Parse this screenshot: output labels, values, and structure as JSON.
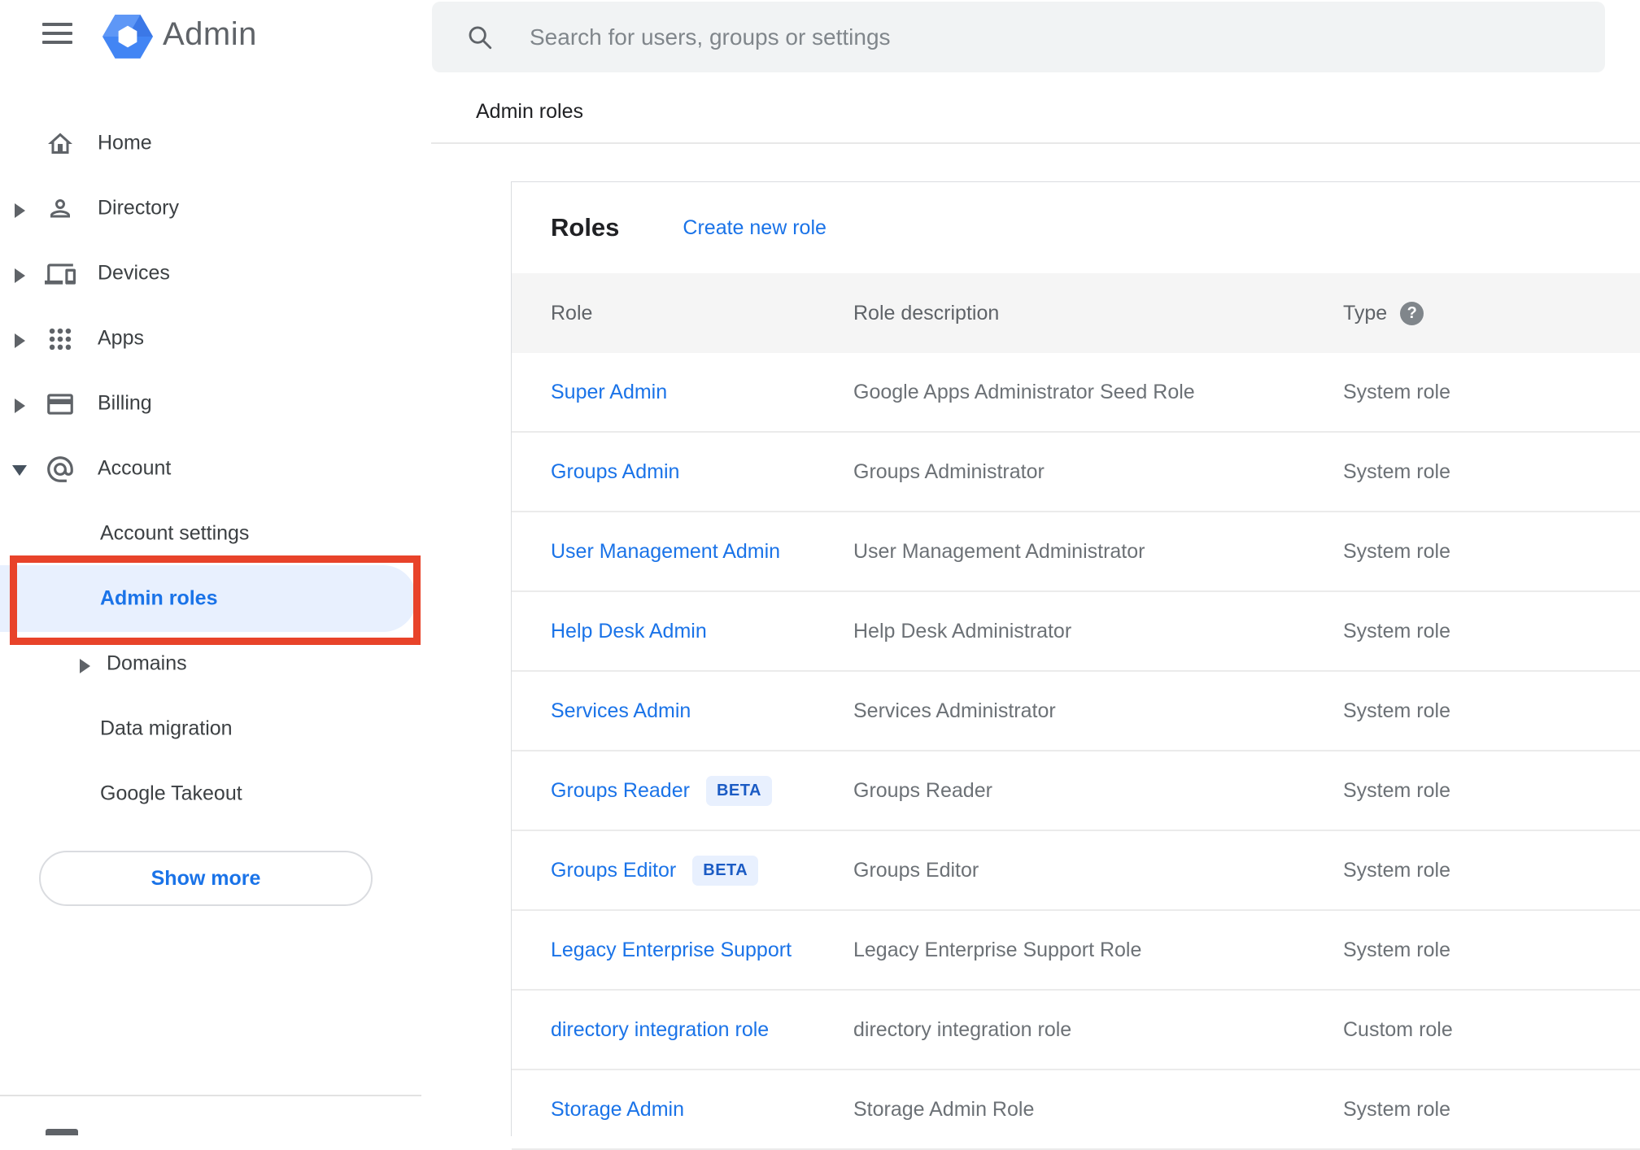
{
  "header": {
    "app_title": "Admin",
    "search_placeholder": "Search for users, groups or settings",
    "breadcrumb": "Admin roles"
  },
  "sidebar": {
    "items": [
      {
        "label": "Home",
        "icon": "home-icon",
        "triangle": "none",
        "level": 0
      },
      {
        "label": "Directory",
        "icon": "person-icon",
        "triangle": "right",
        "level": 0
      },
      {
        "label": "Devices",
        "icon": "devices-icon",
        "triangle": "right",
        "level": 0
      },
      {
        "label": "Apps",
        "icon": "apps-grid-icon",
        "triangle": "right",
        "level": 0
      },
      {
        "label": "Billing",
        "icon": "credit-card-icon",
        "triangle": "right",
        "level": 0
      },
      {
        "label": "Account",
        "icon": "at-sign-icon",
        "triangle": "down",
        "level": 0
      },
      {
        "label": "Account settings",
        "icon": "",
        "triangle": "none",
        "level": 1
      },
      {
        "label": "Admin roles",
        "icon": "",
        "triangle": "none",
        "level": 1,
        "selected": true
      },
      {
        "label": "Domains",
        "icon": "",
        "triangle": "right",
        "level": 1
      },
      {
        "label": "Data migration",
        "icon": "",
        "triangle": "none",
        "level": 1
      },
      {
        "label": "Google Takeout",
        "icon": "",
        "triangle": "none",
        "level": 1
      }
    ],
    "show_more_label": "Show more"
  },
  "main": {
    "card_title": "Roles",
    "create_link_label": "Create new role",
    "table": {
      "columns": [
        "Role",
        "Role description",
        "Type"
      ],
      "type_help_glyph": "?",
      "rows": [
        {
          "role": "Super Admin",
          "beta": false,
          "description": "Google Apps Administrator Seed Role",
          "type": "System role"
        },
        {
          "role": "Groups Admin",
          "beta": false,
          "description": "Groups Administrator",
          "type": "System role"
        },
        {
          "role": "User Management Admin",
          "beta": false,
          "description": "User Management Administrator",
          "type": "System role"
        },
        {
          "role": "Help Desk Admin",
          "beta": false,
          "description": "Help Desk Administrator",
          "type": "System role"
        },
        {
          "role": "Services Admin",
          "beta": false,
          "description": "Services Administrator",
          "type": "System role"
        },
        {
          "role": "Groups Reader",
          "beta": true,
          "beta_label": "BETA",
          "description": "Groups Reader",
          "type": "System role"
        },
        {
          "role": "Groups Editor",
          "beta": true,
          "beta_label": "BETA",
          "description": "Groups Editor",
          "type": "System role"
        },
        {
          "role": "Legacy Enterprise Support",
          "beta": false,
          "description": "Legacy Enterprise Support Role",
          "type": "System role"
        },
        {
          "role": "directory integration role",
          "beta": false,
          "description": "directory integration role",
          "type": "Custom role"
        },
        {
          "role": "Storage Admin",
          "beta": false,
          "description": "Storage Admin Role",
          "type": "System role"
        }
      ]
    }
  },
  "colors": {
    "link_blue": "#1a73e8",
    "selected_pill_bg": "#e8f0fe",
    "annotation_red": "#e8432a",
    "table_header_bg": "#f5f5f5",
    "search_bg": "#f1f3f4",
    "text_dark": "#202124",
    "text_gray": "#5f6368",
    "logo_blue": "#4285f4"
  }
}
